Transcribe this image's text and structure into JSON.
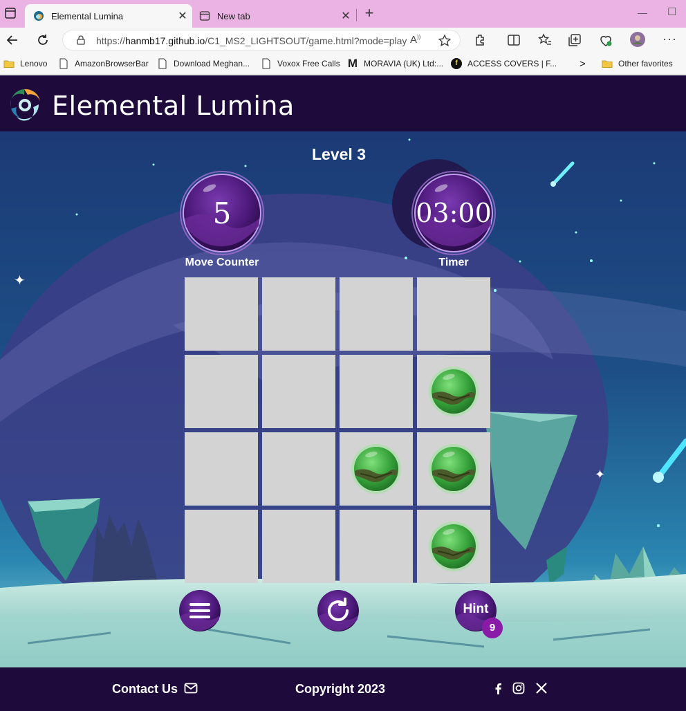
{
  "browser": {
    "tabs": [
      {
        "title": "Elemental Lumina",
        "active": true
      },
      {
        "title": "New tab",
        "active": false
      }
    ],
    "new_tab_symbol": "+",
    "close_symbol": "✕",
    "address": {
      "prefix": "https://",
      "host": "hanmb17.github.io",
      "path": "/C1_MS2_LIGHTSOUT/game.html?mode=play"
    },
    "favorites": [
      {
        "label": "Lenovo",
        "icon": "folder-icon"
      },
      {
        "label": "AmazonBrowserBar",
        "icon": "page-icon"
      },
      {
        "label": "Download Meghan...",
        "icon": "page-icon"
      },
      {
        "label": "Voxox Free Calls",
        "icon": "page-icon"
      },
      {
        "label": "MORAVIA (UK) Ltd:...",
        "icon": "m-logo-icon"
      },
      {
        "label": "ACCESS COVERS | F...",
        "icon": "f-logo-icon"
      }
    ],
    "favorites_more": ">",
    "other_favorites": "Other favorites"
  },
  "site": {
    "title": "Elemental Lumina",
    "logo_icon": "elemental-swirl-logo"
  },
  "game": {
    "level_label": "Level 3",
    "move_counter": {
      "value": "5",
      "label": "Move Counter"
    },
    "timer": {
      "value": "03:00",
      "label": "Timer"
    },
    "grid": [
      [
        false,
        false,
        false,
        false
      ],
      [
        false,
        false,
        false,
        true
      ],
      [
        false,
        false,
        true,
        true
      ],
      [
        false,
        false,
        false,
        true
      ]
    ],
    "lit_icon": "earth-orb-icon",
    "controls": {
      "menu_icon": "hamburger-menu-icon",
      "restart_icon": "restart-icon",
      "hint_label": "Hint",
      "hint_count": "9"
    }
  },
  "footer": {
    "contact_label": "Contact Us",
    "contact_icon": "envelope-icon",
    "copyright": "Copyright 2023",
    "social": [
      "facebook-icon",
      "instagram-icon",
      "x-icon"
    ]
  },
  "colors": {
    "header_bg": "#1e0b3c",
    "cell_bg": "#d3d3d3",
    "orb_purple": "#5a1d8a",
    "lit_green": "#3fae3a",
    "hint_badge": "#8a1aa8",
    "tab_bar": "#eab3e3"
  }
}
